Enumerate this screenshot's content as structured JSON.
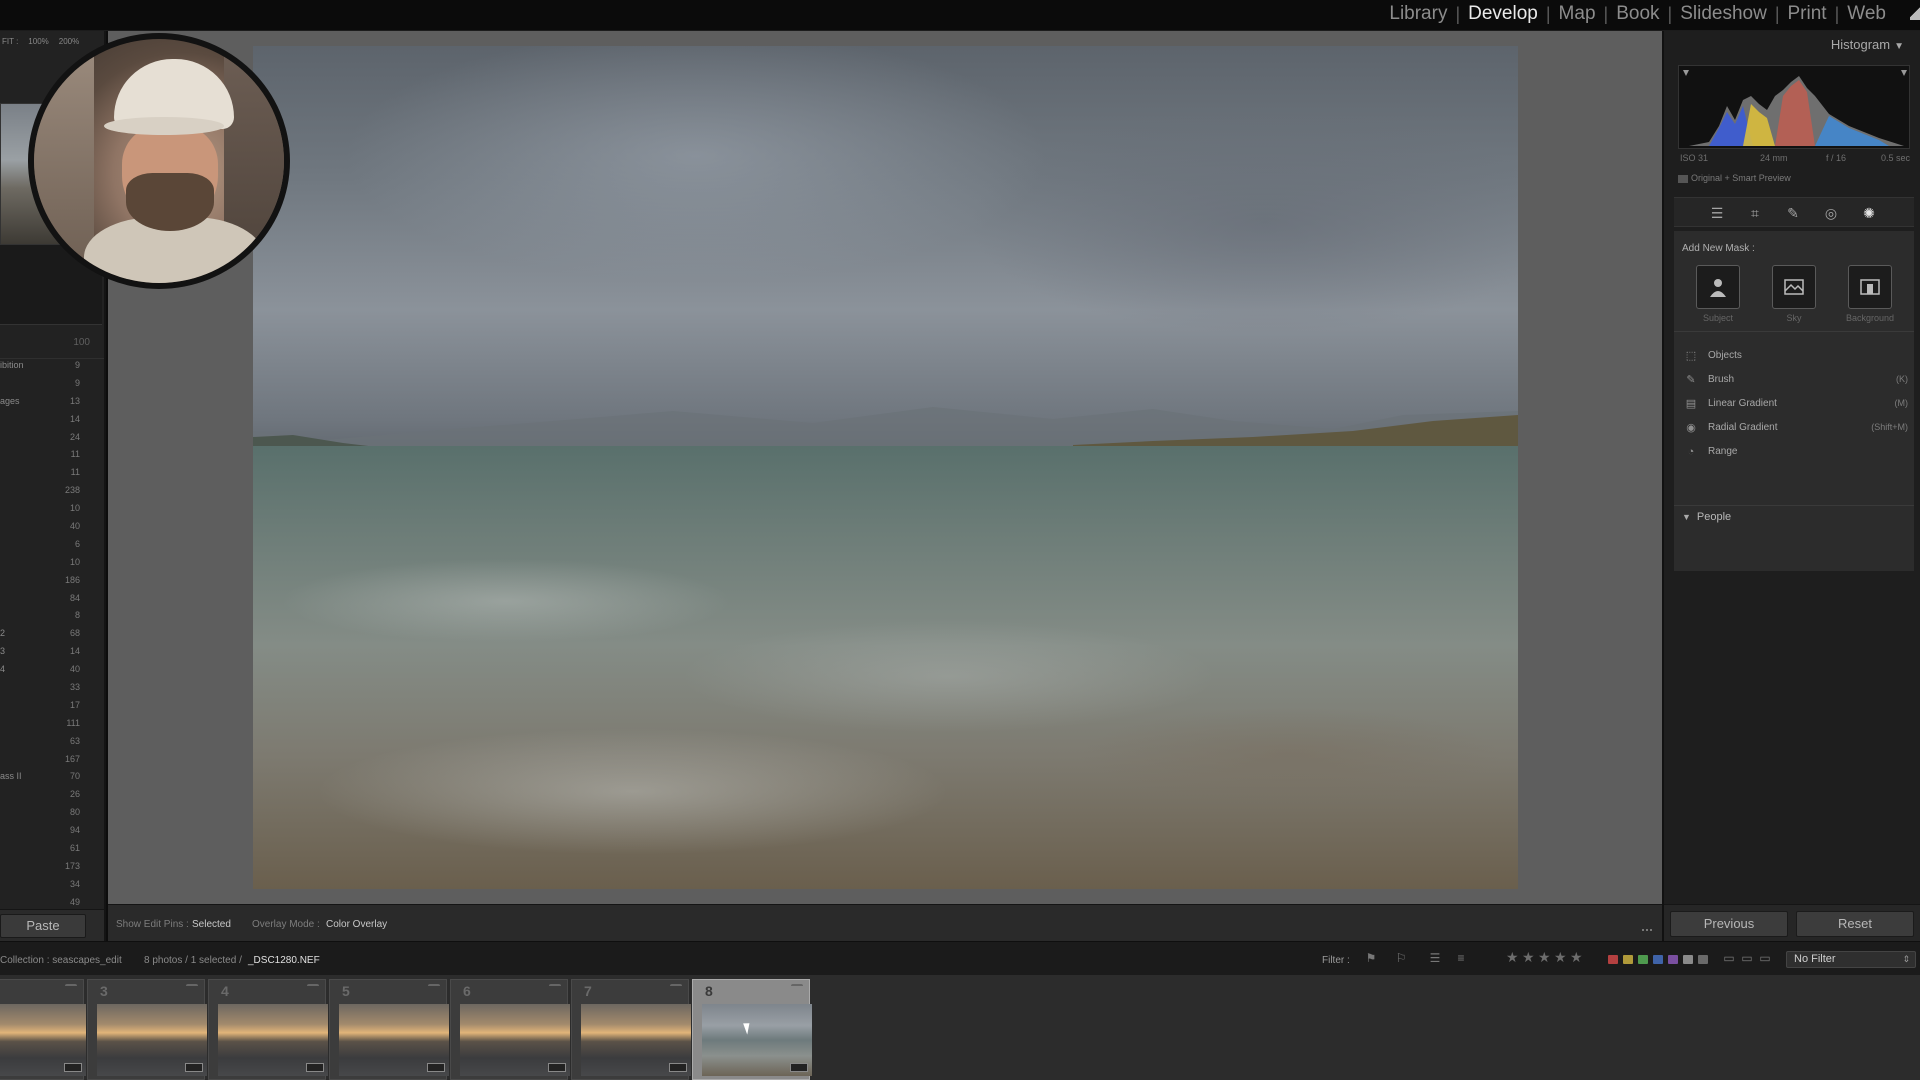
{
  "top_bar": {
    "modules": [
      {
        "label": "Library",
        "active": false
      },
      {
        "label": "Develop",
        "active": true
      },
      {
        "label": "Map",
        "active": false
      },
      {
        "label": "Book",
        "active": false
      },
      {
        "label": "Slideshow",
        "active": false
      },
      {
        "label": "Print",
        "active": false
      },
      {
        "label": "Web",
        "active": false
      }
    ],
    "separator": "|"
  },
  "left_panel": {
    "navigator_zoom": [
      "FIT :",
      "100%",
      "200%"
    ],
    "collection_count": "100",
    "collections": [
      {
        "name": "ibition",
        "count": "9"
      },
      {
        "name": "",
        "count": "9"
      },
      {
        "name": "ages",
        "count": "13"
      },
      {
        "name": "",
        "count": "14"
      },
      {
        "name": "",
        "count": "24"
      },
      {
        "name": "",
        "count": "11"
      },
      {
        "name": "",
        "count": "11"
      },
      {
        "name": "",
        "count": "238"
      },
      {
        "name": "",
        "count": "10"
      },
      {
        "name": "",
        "count": "40"
      },
      {
        "name": "",
        "count": "6"
      },
      {
        "name": "",
        "count": "10"
      },
      {
        "name": "",
        "count": "186"
      },
      {
        "name": "",
        "count": "84"
      },
      {
        "name": "",
        "count": "8"
      },
      {
        "name": "2",
        "count": "68"
      },
      {
        "name": "3",
        "count": "14"
      },
      {
        "name": "4",
        "count": "40"
      },
      {
        "name": "",
        "count": "33"
      },
      {
        "name": "",
        "count": "17"
      },
      {
        "name": "",
        "count": "111"
      },
      {
        "name": "",
        "count": "63"
      },
      {
        "name": "",
        "count": "167"
      },
      {
        "name": "ass II",
        "count": "70"
      },
      {
        "name": "",
        "count": "26"
      },
      {
        "name": "",
        "count": "80"
      },
      {
        "name": "",
        "count": "94"
      },
      {
        "name": "",
        "count": "61"
      },
      {
        "name": "",
        "count": "173"
      },
      {
        "name": "",
        "count": "34"
      },
      {
        "name": "",
        "count": "49"
      }
    ],
    "paste_label": "Paste"
  },
  "toolbar": {
    "show_edit_pins_label": "Show Edit Pins :",
    "show_edit_pins_value": "Selected",
    "overlay_mode_label": "Overlay Mode :",
    "overlay_mode_value": "Color Overlay"
  },
  "right_panel": {
    "histogram_title": "Histogram",
    "exif": {
      "iso": "ISO 31",
      "focal": "24 mm",
      "aperture": "f / 16",
      "shutter": "0.5 sec"
    },
    "preview_status": "Original + Smart Preview",
    "tools": [
      "edit-sliders-icon",
      "crop-icon",
      "healing-brush-icon",
      "red-eye-icon",
      "masking-icon"
    ],
    "mask": {
      "add_label": "Add New Mask :",
      "quick_masks": [
        {
          "label": "Subject",
          "icon": "subject-icon"
        },
        {
          "label": "Sky",
          "icon": "sky-icon"
        },
        {
          "label": "Background",
          "icon": "background-icon"
        }
      ],
      "tools": [
        {
          "label": "Objects",
          "shortcut": "",
          "icon": "objects-icon"
        },
        {
          "label": "Brush",
          "shortcut": "(K)",
          "icon": "brush-icon"
        },
        {
          "label": "Linear Gradient",
          "shortcut": "(M)",
          "icon": "linear-gradient-icon"
        },
        {
          "label": "Radial Gradient",
          "shortcut": "(Shift+M)",
          "icon": "radial-gradient-icon"
        },
        {
          "label": "Range",
          "shortcut": "",
          "icon": "range-icon"
        }
      ],
      "people_label": "People"
    },
    "previous_label": "Previous",
    "reset_label": "Reset"
  },
  "filmstrip": {
    "breadcrumb": "Collection : seascapes_edit",
    "count": "8 photos / 1 selected /",
    "filename": "_DSC1280.NEF",
    "filter_label": "Filter :",
    "filter_value": "No Filter",
    "rating_stars": 5,
    "color_labels": [
      "#b44040",
      "#b09a3a",
      "#4e9a4e",
      "#3f63a8",
      "#7a4fa0",
      "#8a8a8a",
      "#6a6a6a"
    ],
    "thumbnails": [
      {
        "number": "",
        "selected": false,
        "type": "sunset"
      },
      {
        "number": "3",
        "selected": false,
        "type": "sunset"
      },
      {
        "number": "4",
        "selected": false,
        "type": "sunset"
      },
      {
        "number": "5",
        "selected": false,
        "type": "sunset"
      },
      {
        "number": "6",
        "selected": false,
        "type": "sunset"
      },
      {
        "number": "7",
        "selected": false,
        "type": "sunset"
      },
      {
        "number": "8",
        "selected": true,
        "type": "storm"
      }
    ]
  },
  "colors": {
    "active_module": "#eaeaea",
    "inactive_module": "#8c8c8c",
    "panel_bg": "#1e1e1e",
    "canvas_bg": "#5e5e5e"
  }
}
